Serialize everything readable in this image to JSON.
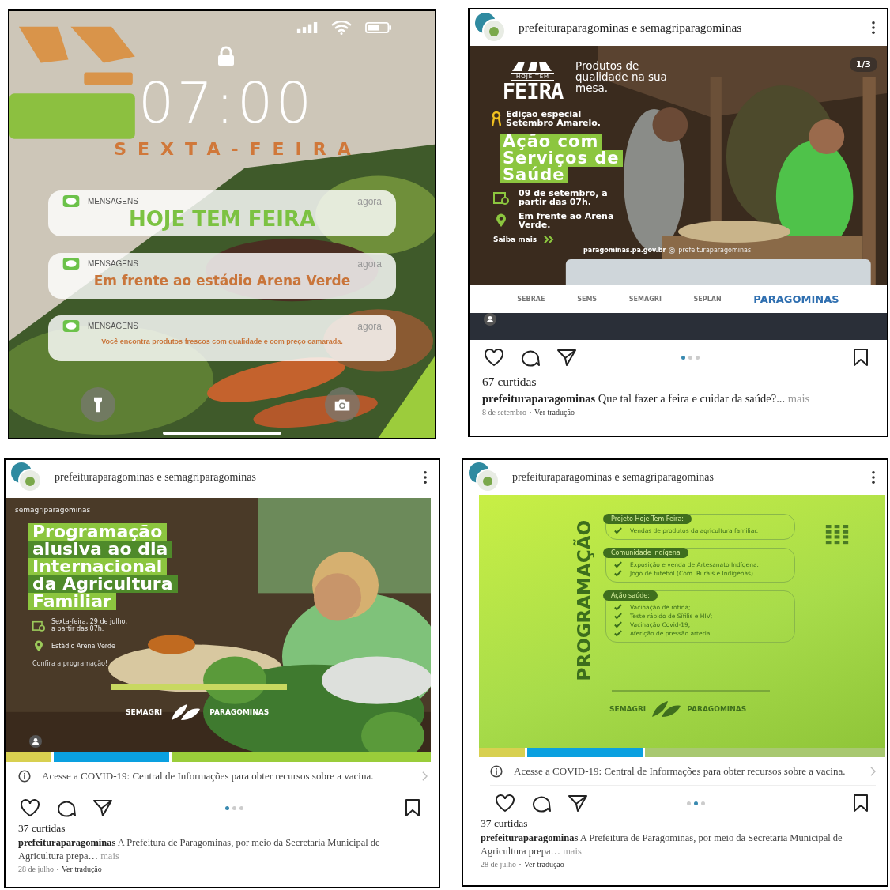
{
  "lock_screen": {
    "time": "07:00",
    "day": "SEXTA-FEIRA",
    "notifications": [
      {
        "app": "MENSAGENS",
        "time": "agora",
        "text": "HOJE TEM FEIRA",
        "kind": "headline"
      },
      {
        "app": "MENSAGENS",
        "time": "agora",
        "text": "Em frente ao estádio Arena Verde",
        "kind": "title"
      },
      {
        "app": "MENSAGENS",
        "time": "agora",
        "text": "Você encontra produtos frescos com qualidade e com preço camarada.",
        "kind": "body"
      }
    ]
  },
  "posts": [
    {
      "authors": "prefeituraparagominas e semagriparagominas",
      "poster": {
        "kind": "feira",
        "counter": "1/3",
        "logo_caption": "HOJE TEM",
        "logo": "FEIRA",
        "tagline": "Produtos de qualidade na sua mesa.",
        "edition": "Edição especial Setembro Amarelo.",
        "headline": [
          "Ação com",
          "Serviços de",
          "Saúde"
        ],
        "date": "09 de setembro, a partir das 07h.",
        "place": "Em frente ao Arena Verde.",
        "link": "Saiba mais",
        "site": "paragominas.pa.gov.br",
        "social": "prefeituraparagominas",
        "sponsors": [
          "SEBRAE",
          "SEMS",
          "SEMAGRI",
          "SEPLAN",
          "PARAGOMINAS"
        ]
      },
      "dots": [
        {
          "selected": true
        },
        {
          "selected": false
        },
        {
          "selected": false
        }
      ],
      "likes": "67 curtidas",
      "user": "prefeituraparagominas",
      "caption": "Que tal fazer a feira e cuidar da saúde?...",
      "more": "mais",
      "date": "8 de setembro",
      "translate": "Ver tradução"
    },
    {
      "authors": "prefeituraparagominas e semagriparagominas",
      "poster": {
        "kind": "agricultura",
        "handle": "semagriparagominas",
        "headline": [
          "Programação",
          "alusiva ao dia",
          "Internacional",
          "da Agricultura",
          "Familiar"
        ],
        "date": "Sexta-feira, 29 de julho, a partir das 07h.",
        "place": "Estádio Arena Verde",
        "link": "Confira a programação!",
        "sponsors": [
          "SEMAGRI",
          "PARAGOMINAS"
        ]
      },
      "covid_notice": "Acesse a COVID-19: Central de Informações para obter recursos sobre a vacina.",
      "dots": [
        {
          "selected": true
        },
        {
          "selected": false
        },
        {
          "selected": false
        }
      ],
      "likes": "37 curtidas",
      "user": "prefeituraparagominas",
      "caption": "A Prefeitura de Paragominas, por meio da Secretaria Municipal de Agricultura prepa…",
      "more": "mais",
      "date": "28 de julho",
      "translate": "Ver tradução"
    },
    {
      "authors": "prefeituraparagominas e semagriparagominas",
      "poster": {
        "kind": "programacao",
        "title": "PROGRAMAÇÃO",
        "sections": [
          {
            "heading": "Projeto Hoje Tem Feira:",
            "items": [
              "Vendas de produtos da agricultura familiar."
            ]
          },
          {
            "heading": "Comunidade indígena",
            "items": [
              "Exposição e venda de Artesanato Indígena.",
              "Jogo de futebol (Com. Rurais e Indígenas)."
            ]
          },
          {
            "heading": "Ação saúde:",
            "items": [
              "Vacinação de rotina;",
              "Teste rápido de Sífilis e HIV;",
              "Vacinação Covid-19;",
              "Aferição de pressão arterial."
            ]
          }
        ],
        "sponsors": [
          "SEMAGRI",
          "PARAGOMINAS"
        ]
      },
      "covid_notice": "Acesse a COVID-19: Central de Informações para obter recursos sobre a vacina.",
      "dots": [
        {
          "selected": false
        },
        {
          "selected": true
        },
        {
          "selected": false
        }
      ],
      "likes": "37 curtidas",
      "user": "prefeituraparagominas",
      "caption": "A Prefeitura de Paragominas, por meio da Secretaria Municipal de Agricultura prepa…",
      "more": "mais",
      "date": "28 de julho",
      "translate": "Ver tradução"
    }
  ]
}
